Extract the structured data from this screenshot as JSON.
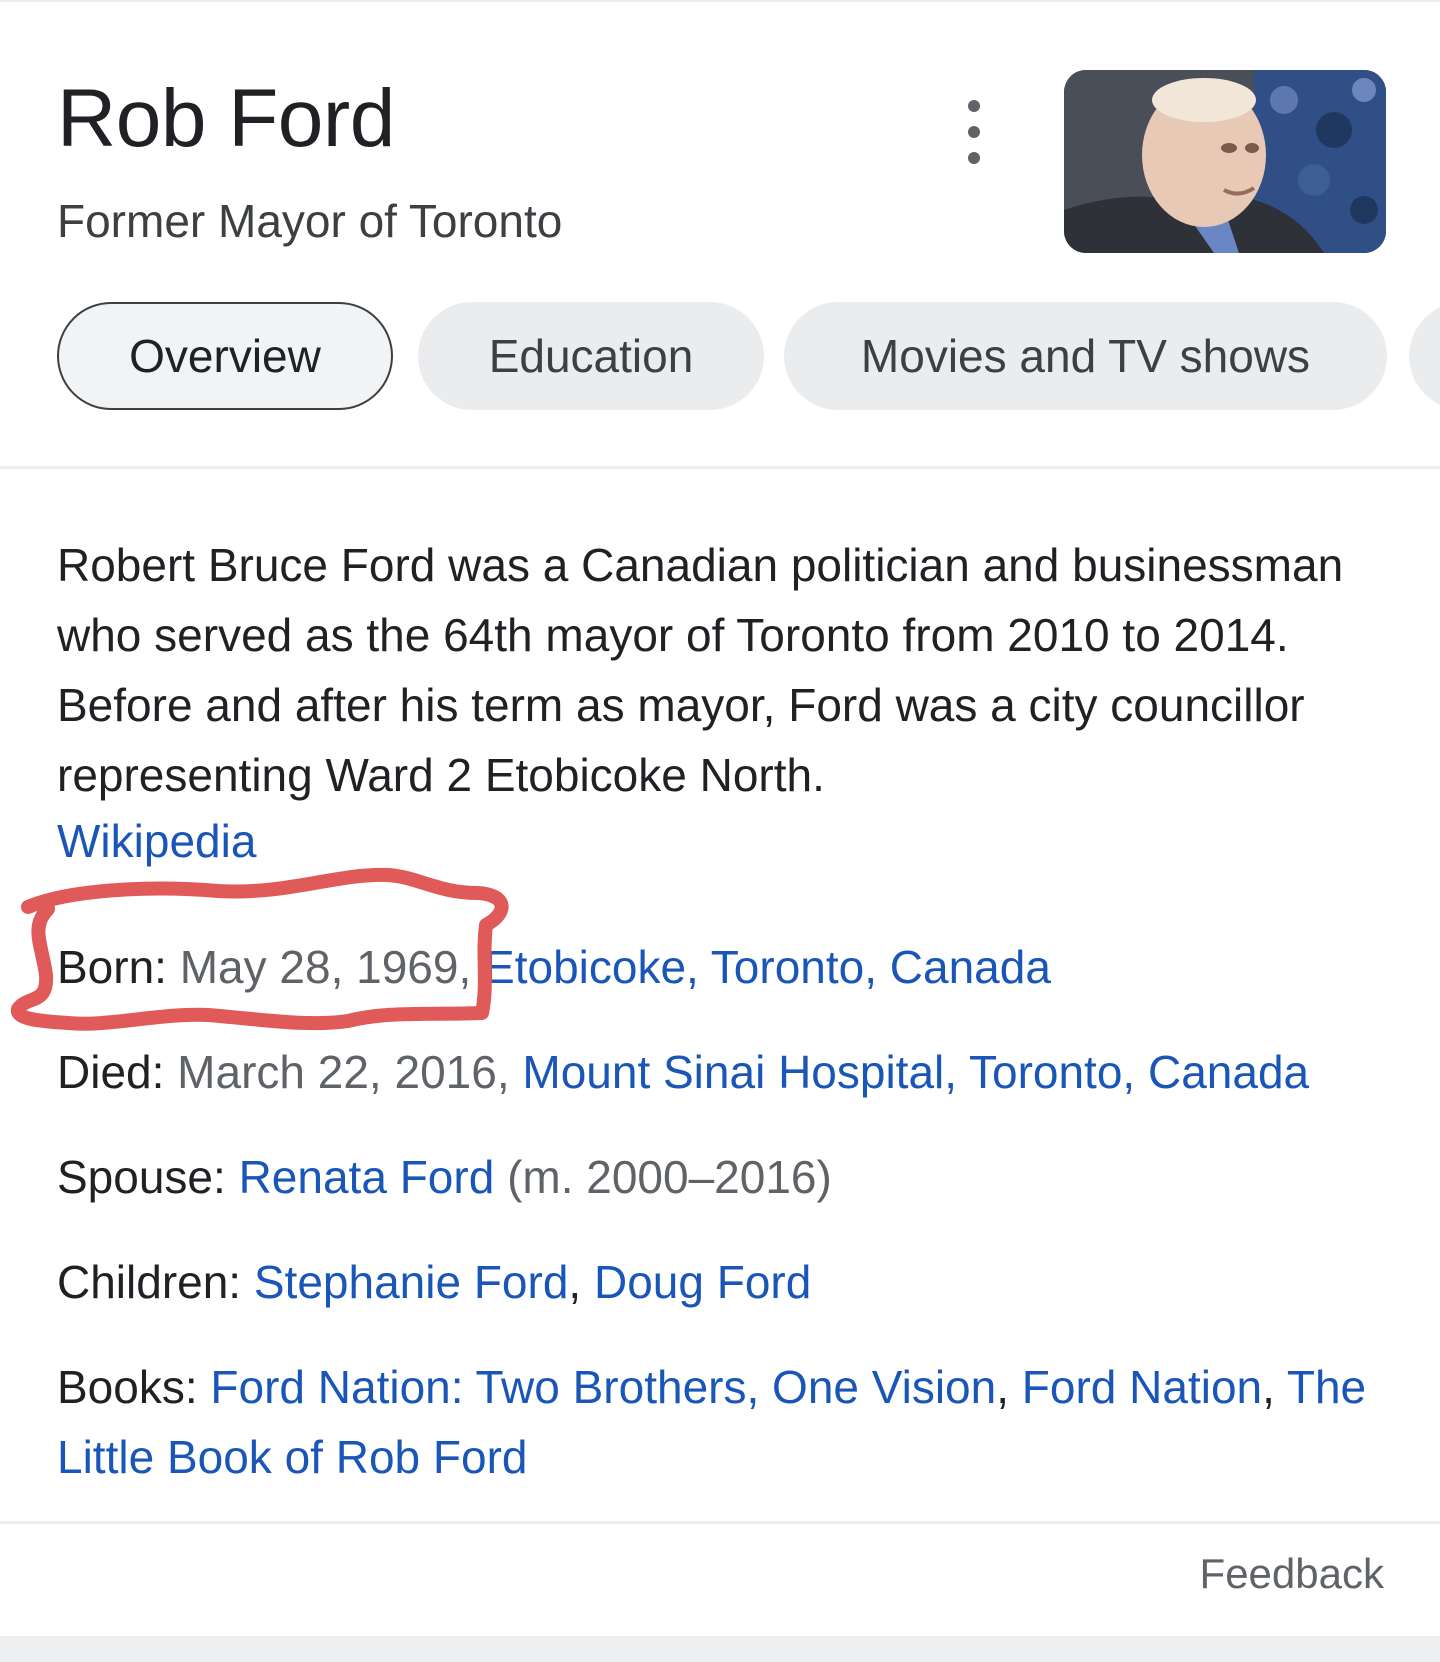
{
  "header": {
    "title": "Rob Ford",
    "subtitle": "Former Mayor of Toronto",
    "more_icon": "more-vert-icon"
  },
  "tabs": [
    {
      "label": "Overview",
      "active": true
    },
    {
      "label": "Education",
      "active": false
    },
    {
      "label": "Movies and TV shows",
      "active": false
    }
  ],
  "description": {
    "text": "Robert Bruce Ford was a Canadian politician and businessman who served as the 64th mayor of Toronto from 2010 to 2014. Before and after his term as mayor, Ford was a city councillor representing Ward 2 Etobicoke North.",
    "source": "Wikipedia"
  },
  "facts": {
    "born": {
      "label": "Born:",
      "date": "May 28, 1969,",
      "place": "Etobicoke, Toronto, Canada"
    },
    "died": {
      "label": "Died:",
      "date": "March 22, 2016,",
      "place": "Mount Sinai Hospital, Toronto, Canada"
    },
    "spouse": {
      "label": "Spouse:",
      "name": "Renata Ford",
      "detail": "(m. 2000–2016)"
    },
    "children": {
      "label": "Children:",
      "items": [
        "Stephanie Ford",
        "Doug Ford"
      ],
      "sep": ", "
    },
    "books": {
      "label": "Books:",
      "items": [
        "Ford Nation: Two Brothers, One Vision",
        "Ford Nation",
        "The Little Book of Rob Ford"
      ],
      "sep": ", "
    }
  },
  "footer": {
    "feedback": "Feedback"
  },
  "colors": {
    "link": "#1a56b8",
    "annotation": "#e05a5a"
  }
}
